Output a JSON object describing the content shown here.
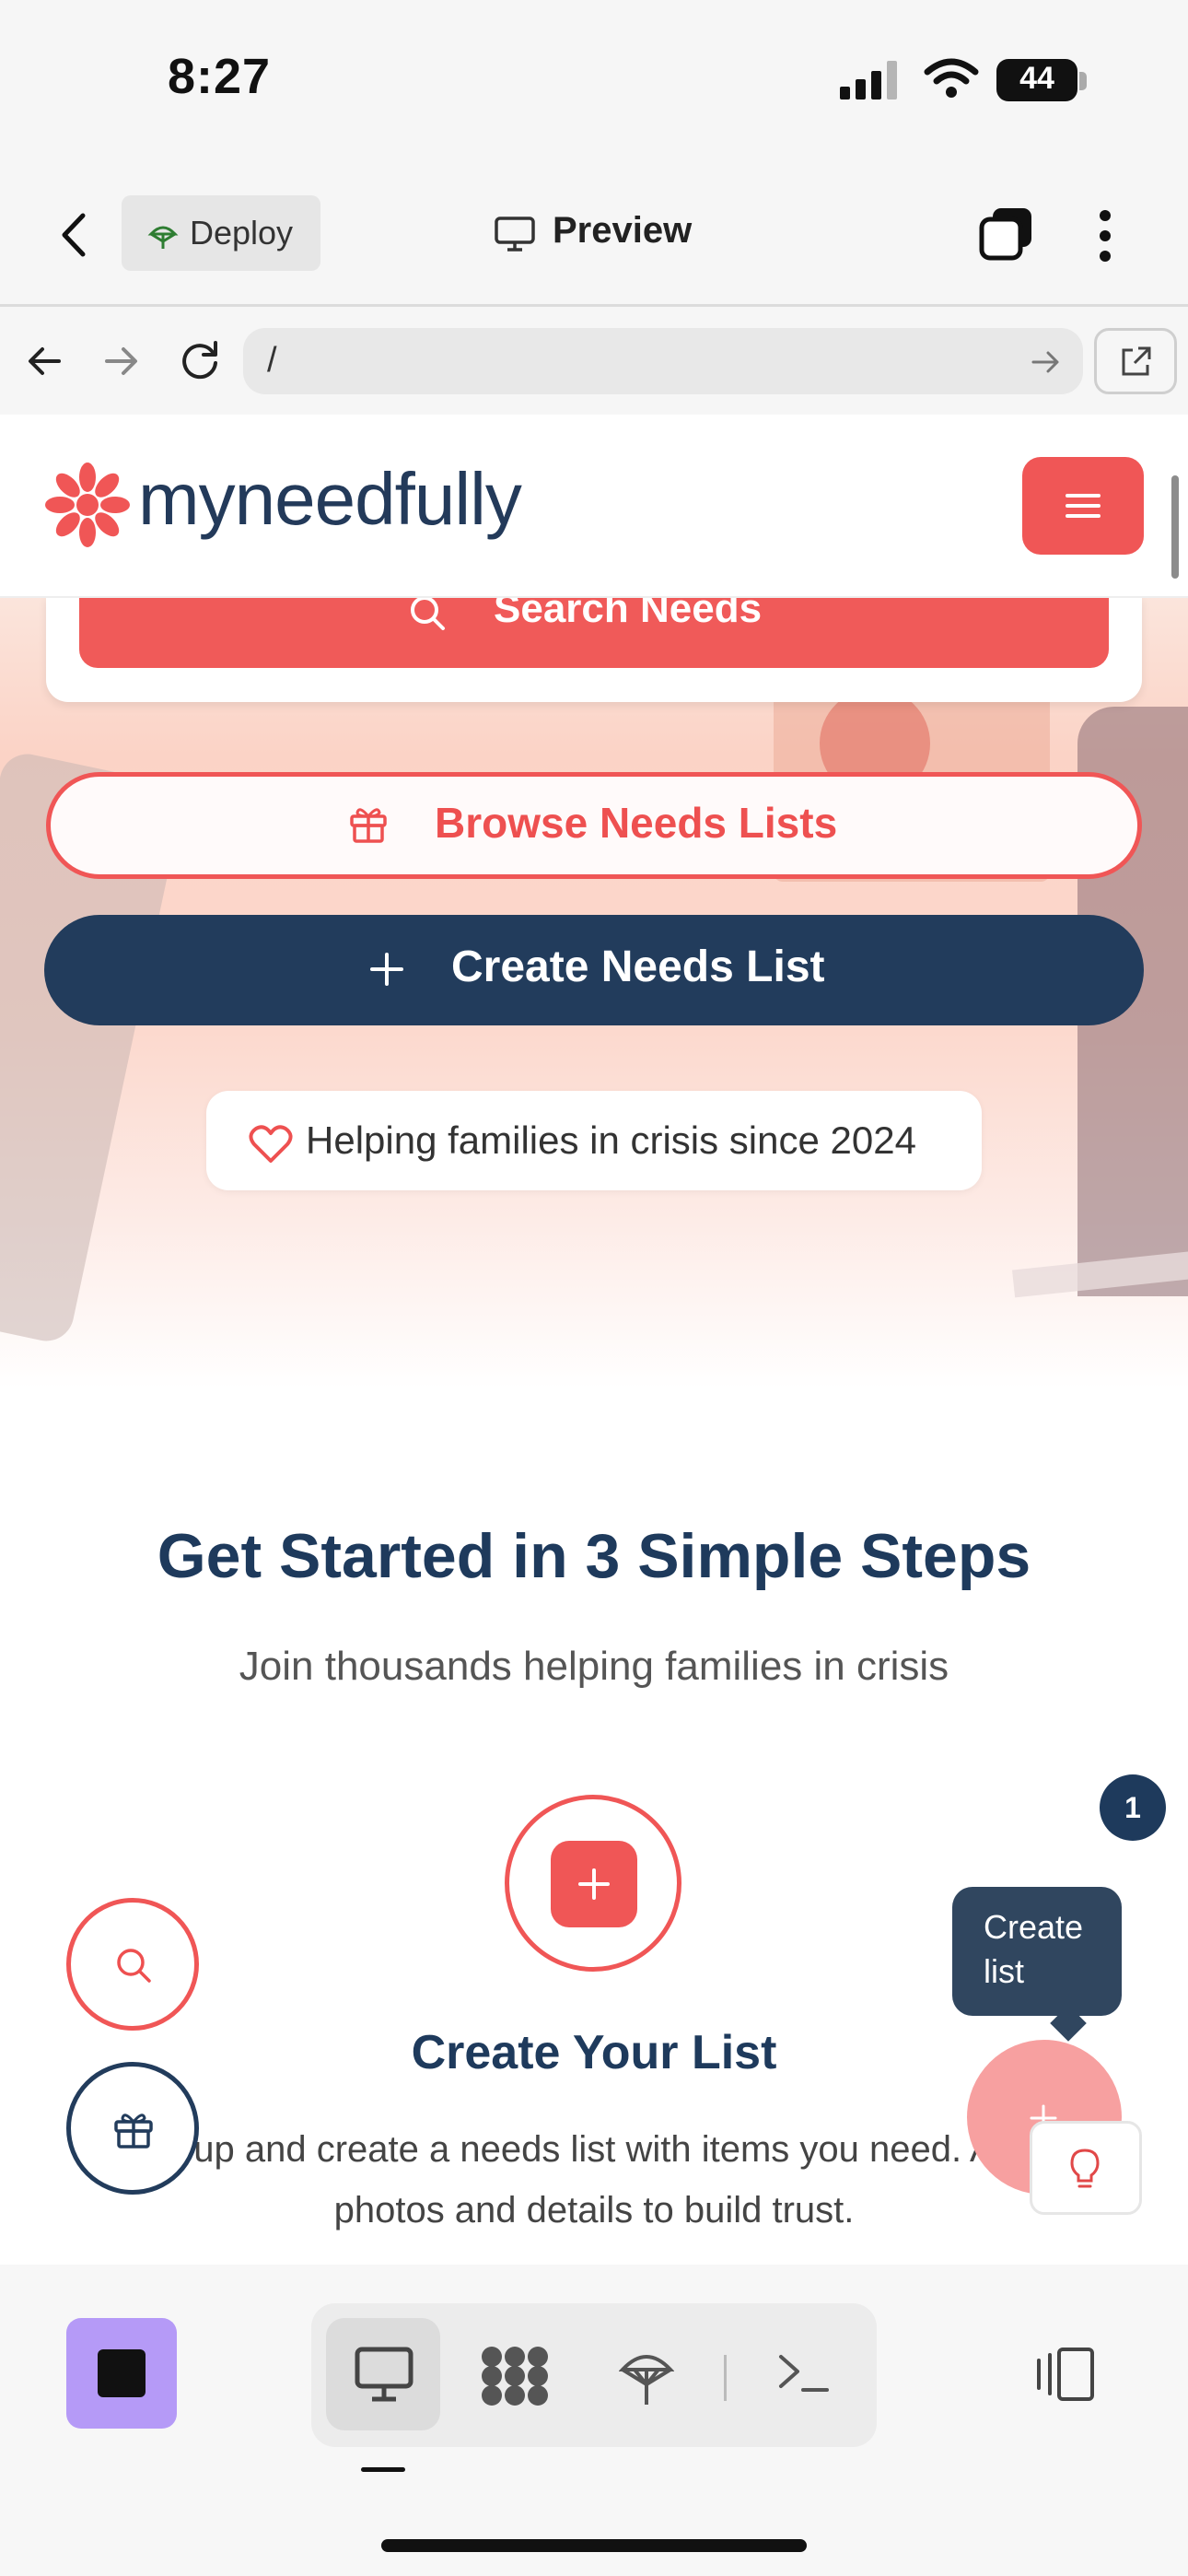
{
  "status": {
    "time": "8:27",
    "battery": "44"
  },
  "app_header": {
    "deploy_label": "Deploy",
    "preview_label": "Preview"
  },
  "browser": {
    "url": "/"
  },
  "site": {
    "logo_text": "myneedfully",
    "search_label": "Search Needs",
    "browse_label": "Browse Needs Lists",
    "create_label": "Create Needs List",
    "tagline": "Helping families in crisis since 2024"
  },
  "steps": {
    "title": "Get Started in 3 Simple Steps",
    "subtitle": "Join thousands helping families in crisis",
    "badge": "1",
    "step1_title": "Create Your List",
    "step1_desc_line1": "up and create a needs list with items you need. A",
    "step1_desc_line2": "photos and details to build trust."
  },
  "fab": {
    "tooltip": "Create list"
  },
  "colors": {
    "brand": "#f05656",
    "navy": "#223c5c",
    "accent_purple": "#b59af7"
  }
}
